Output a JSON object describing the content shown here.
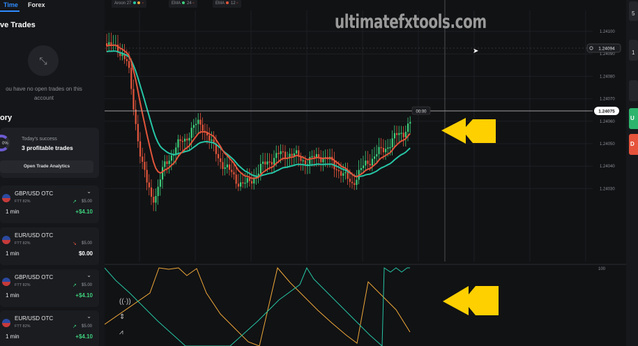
{
  "sidebar": {
    "tabs": [
      "Time",
      "Forex"
    ],
    "live_trades_title": "ve Trades",
    "empty_text": "ou have no open trades on this account",
    "history_title": "ory",
    "success": {
      "ring_text": "0%",
      "label": "Today's success",
      "value": "3 profitable trades",
      "analytics_button": "Open Trade Analytics"
    },
    "trades": [
      {
        "pair": "GBP/USD OTC",
        "ftt": "FTT 82%",
        "duration": "1 min",
        "stake": "$5.00",
        "payout": "+$4.10",
        "direction": "up"
      },
      {
        "pair": "EUR/USD OTC",
        "ftt": "FTT 82%",
        "duration": "1 min",
        "stake": "$5.00",
        "payout": "$0.00",
        "direction": "down"
      },
      {
        "pair": "GBP/USD OTC",
        "ftt": "FTT 82%",
        "duration": "1 min",
        "stake": "$5.00",
        "payout": "+$4.10",
        "direction": "up"
      },
      {
        "pair": "EUR/USD OTC",
        "ftt": "FTT 82%",
        "duration": "1 min",
        "stake": "$5.00",
        "payout": "+$4.10",
        "direction": "up"
      }
    ]
  },
  "indicators": [
    {
      "name": "Aroon",
      "param": "27",
      "colors": [
        "#26c6a6",
        "#f0a93a"
      ]
    },
    {
      "name": "EMA",
      "param": "24",
      "colors": [
        "#3ecf7c"
      ]
    },
    {
      "name": "EMA",
      "param": "12",
      "colors": [
        "#e2553b"
      ]
    }
  ],
  "watermark": "ultimatefxtools.com",
  "price_axis": [
    "1.24100",
    "1.24090",
    "1.24080",
    "1.24070",
    "1.24060",
    "1.24050",
    "1.24040",
    "1.24030"
  ],
  "current_price": "1.24075",
  "crosshair_price": "1.24094",
  "timer": "00:00",
  "oscillator_axis_top": "100",
  "right_panel": {
    "items": [
      "5",
      "1"
    ],
    "up_label": "U",
    "down_label": "D"
  },
  "colors": {
    "bull": "#3ecf7c",
    "bear": "#e2553b",
    "ema_fast": "#e2553b",
    "ema_slow": "#26c6a6",
    "arrow": "#ffd000"
  }
}
